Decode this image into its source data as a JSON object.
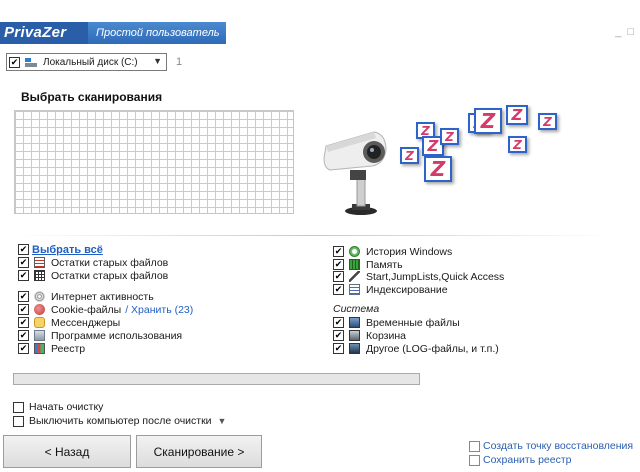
{
  "app": {
    "brand": "PrivaZer",
    "mode": "Простой пользователь",
    "window_controls": [
      "_",
      "□"
    ]
  },
  "drive": {
    "label": "Локальный диск (C:)",
    "checked": true,
    "count": "1"
  },
  "scan": {
    "title": "Выбрать сканирования",
    "progress_fraction": 0
  },
  "left_list": {
    "select_all": "Выбрать всё",
    "group1": [
      {
        "label": "Остатки старых файлов",
        "icon": "file-icon"
      },
      {
        "label": "Остатки старых файлов",
        "icon": "grid-file-icon"
      }
    ],
    "group2": [
      {
        "label": "Интернет активность",
        "icon": "fingerprint-icon"
      },
      {
        "label": "Cookie-файлы",
        "icon": "cookie-icon",
        "link": "/ Хранить (23)"
      },
      {
        "label": "Мессенджеры",
        "icon": "messenger-icon"
      },
      {
        "label": "Программе использования",
        "icon": "program-usage-icon"
      },
      {
        "label": "Реестр",
        "icon": "registry-icon"
      }
    ]
  },
  "right_list": {
    "group1": [
      {
        "label": "История Windows",
        "icon": "history-icon"
      },
      {
        "label": "Память",
        "icon": "memory-icon"
      },
      {
        "label": "Start,JumpLists,Quick Access",
        "icon": "jumplist-icon"
      },
      {
        "label": "Индексирование",
        "icon": "index-icon"
      }
    ],
    "system_label": "Система",
    "group2": [
      {
        "label": "Временные файлы",
        "icon": "temp-files-icon"
      },
      {
        "label": "Корзина",
        "icon": "recycle-bin-icon"
      },
      {
        "label": "Другое (LOG-файлы, и т.п.)",
        "icon": "log-files-icon"
      }
    ]
  },
  "options": {
    "start_cleanup": "Начать очистку",
    "shutdown_after": "Выключить компьютер после очистки"
  },
  "buttons": {
    "back": "< Назад",
    "scan": "Сканирование >"
  },
  "extra": {
    "restore_point": "Создать точку восстановления",
    "save_registry": "Сохранить реестр"
  },
  "colors": {
    "accent": "#2f6bb8",
    "link": "#1f5fc4",
    "z_badge": "#d43a6b"
  }
}
